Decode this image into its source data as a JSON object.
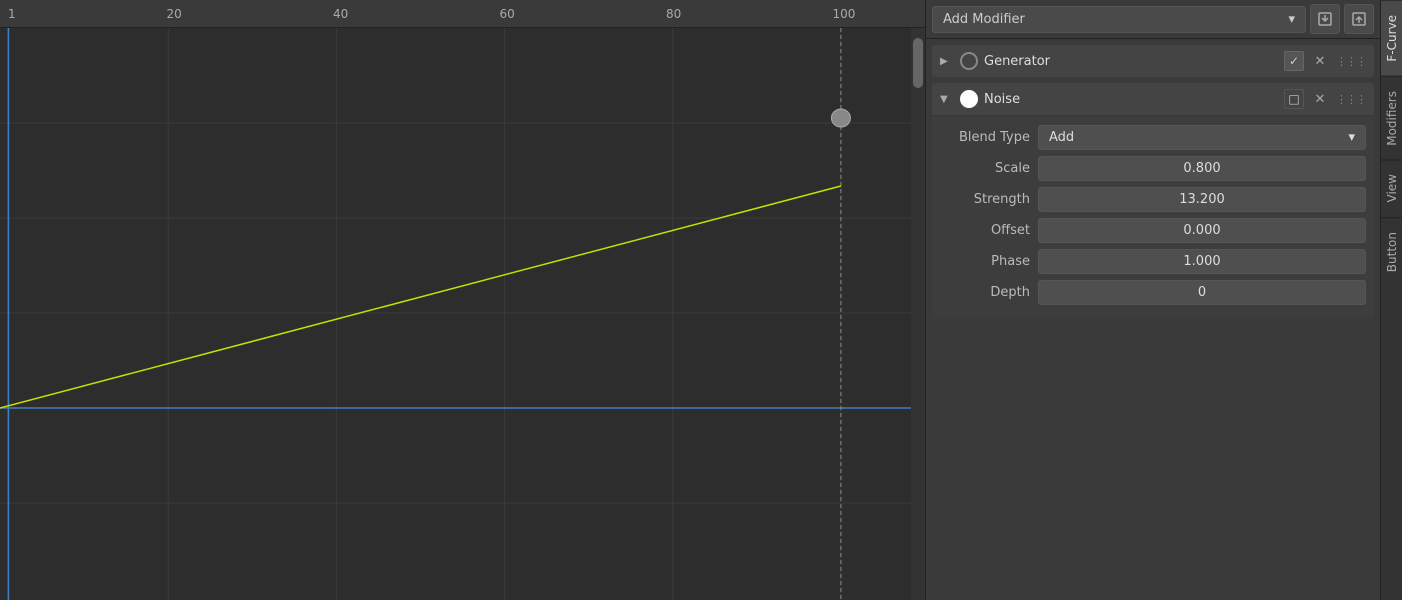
{
  "ruler": {
    "ticks": [
      {
        "label": "1",
        "pct": 0
      },
      {
        "label": "20",
        "pct": 20.5
      },
      {
        "label": "40",
        "pct": 38.5
      },
      {
        "label": "60",
        "pct": 56.5
      },
      {
        "label": "80",
        "pct": 74.5
      },
      {
        "label": "100",
        "pct": 92
      }
    ]
  },
  "toolbar": {
    "add_modifier_label": "Add Modifier",
    "add_modifier_dropdown_arrow": "▾",
    "import_icon": "⬆",
    "export_icon": "⬇"
  },
  "modifiers": [
    {
      "id": "generator",
      "name": "Generator",
      "collapsed": true,
      "checked": true,
      "icon_filled": false,
      "arrow": "▶"
    },
    {
      "id": "noise",
      "name": "Noise",
      "collapsed": false,
      "checked": false,
      "icon_filled": true,
      "arrow": "▼",
      "fields": [
        {
          "label": "Blend Type",
          "type": "dropdown",
          "value": "Add"
        },
        {
          "label": "Scale",
          "type": "number",
          "value": "0.800"
        },
        {
          "label": "Strength",
          "type": "number",
          "value": "13.200"
        },
        {
          "label": "Offset",
          "type": "number",
          "value": "0.000"
        },
        {
          "label": "Phase",
          "type": "number",
          "value": "1.000"
        },
        {
          "label": "Depth",
          "type": "number",
          "value": "0"
        }
      ]
    }
  ],
  "side_tabs": [
    {
      "label": "F-Curve",
      "active": true
    },
    {
      "label": "Modifiers",
      "active": false
    },
    {
      "label": "View",
      "active": false
    },
    {
      "label": "Button",
      "active": false
    }
  ],
  "colors": {
    "curve_line": "#c8e000",
    "grid_line": "#3a3a3a",
    "axis_x": "#4080c0",
    "axis_y": "#4080c0",
    "bg": "#2d2d2d",
    "cursor": "#666"
  }
}
